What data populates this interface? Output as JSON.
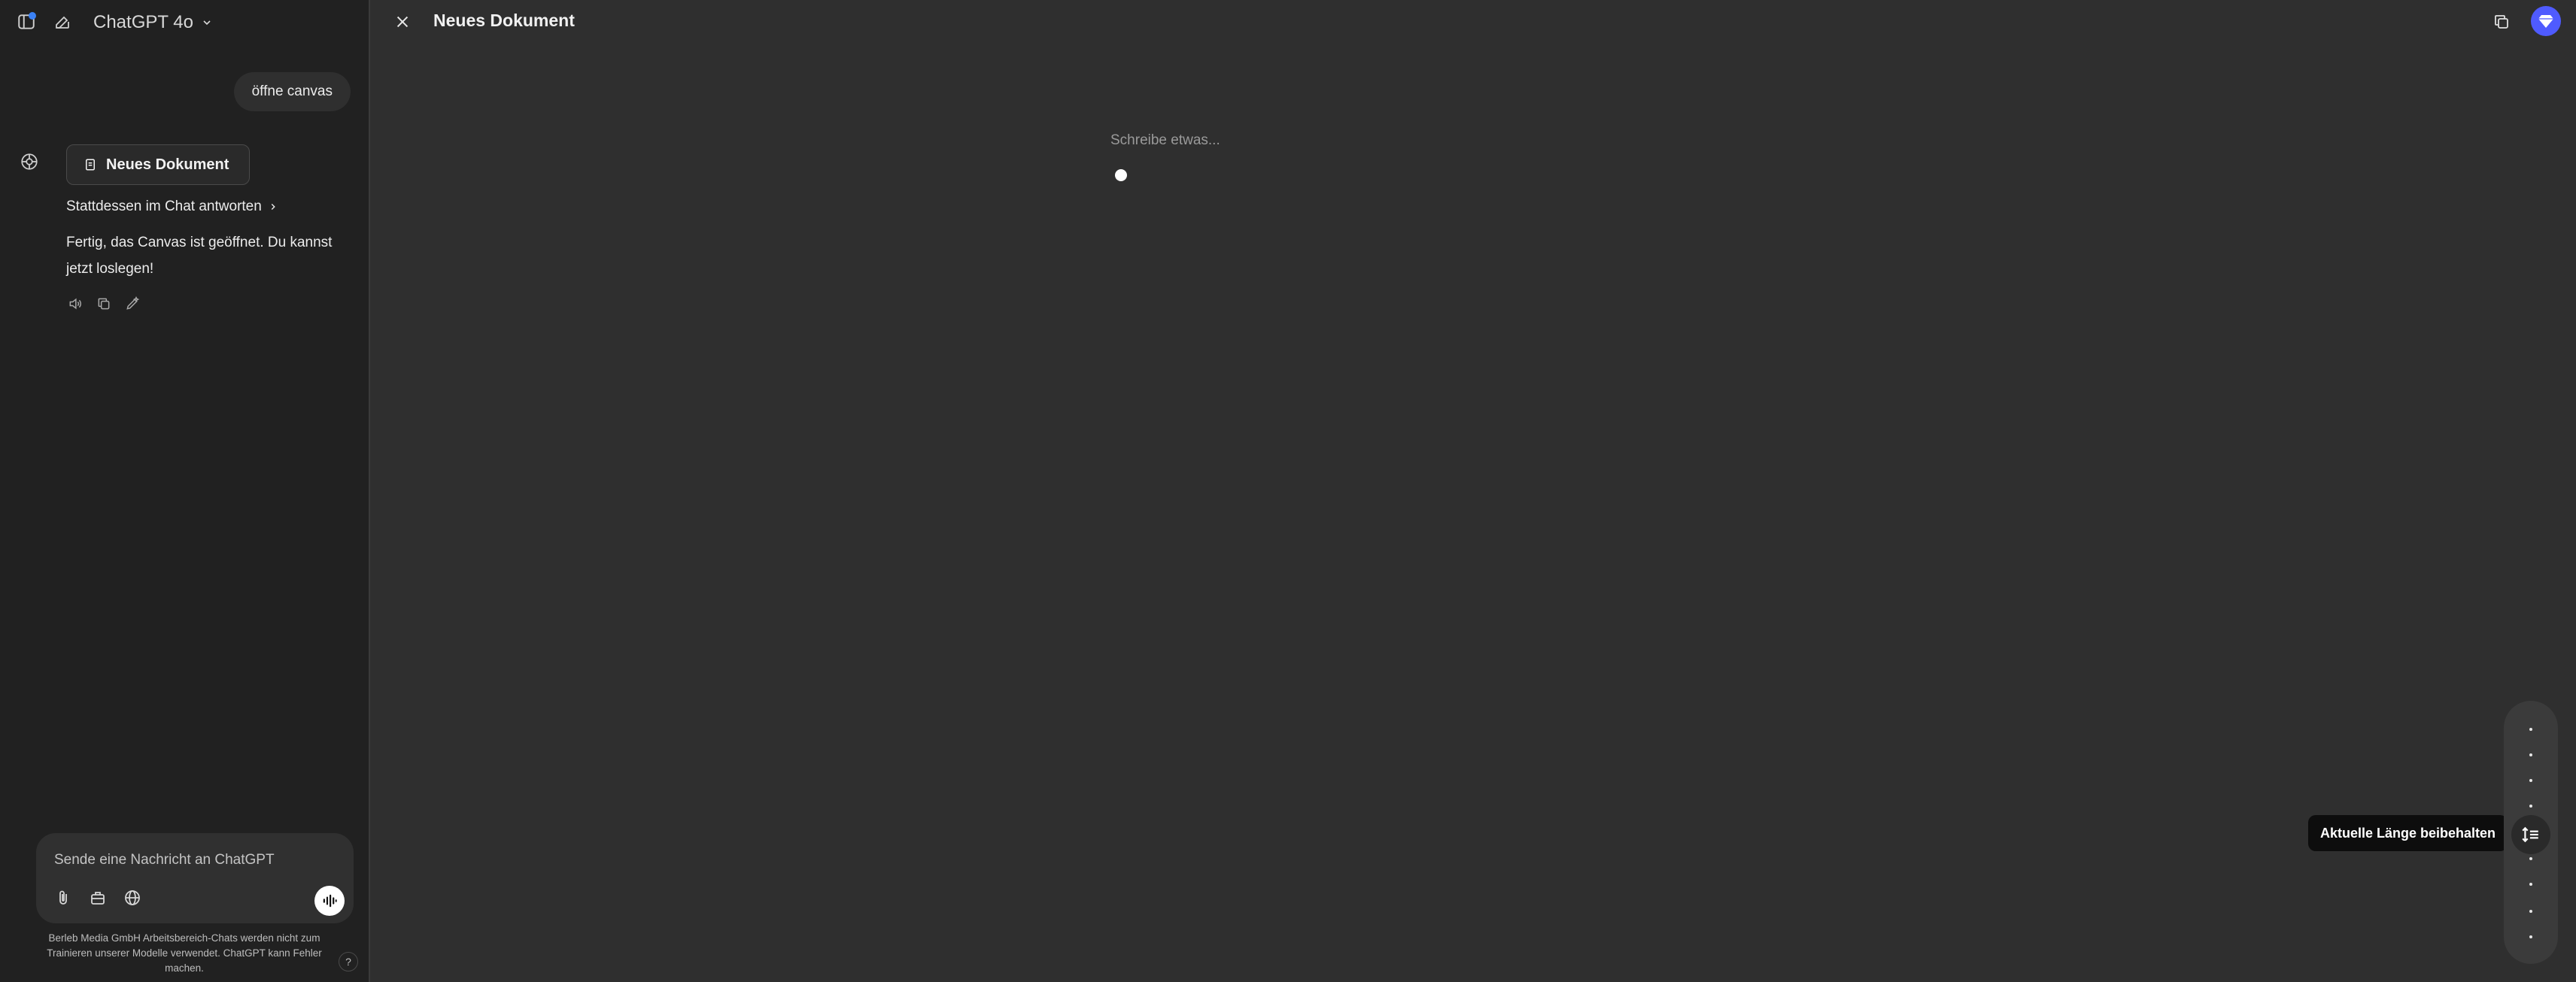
{
  "sidebar": {
    "model_name": "ChatGPT 4o",
    "user_message": "öffne canvas",
    "document_chip_label": "Neues Dokument",
    "alt_answer_link": "Stattdessen im Chat antworten",
    "assistant_message": "Fertig, das Canvas ist geöffnet. Du kannst jetzt loslegen!",
    "composer": {
      "placeholder": "Sende eine Nachricht an ChatGPT"
    },
    "disclaimer": "Berleb Media GmbH Arbeitsbereich-Chats werden nicht zum Trainieren unserer Modelle verwendet. ChatGPT kann Fehler machen.",
    "help_label": "?",
    "icons": {
      "sidebar_toggle": "sidebar-toggle-icon",
      "new_chat": "compose-icon",
      "model_chevron": "chevron-down-icon",
      "assistant": "openai-logo-icon",
      "document": "document-icon",
      "link_chevron": "chevron-right-icon",
      "read_aloud": "speaker-icon",
      "copy": "copy-icon",
      "edit": "edit-icon",
      "attach": "paperclip-icon",
      "tools": "toolbox-icon",
      "web": "globe-icon",
      "voice": "voice-waveform-icon"
    }
  },
  "canvas": {
    "title": "Neues Dokument",
    "editor_placeholder": "Schreibe etwas...",
    "length_tooltip": "Aktuelle Länge beibehalten",
    "icons": {
      "close": "close-icon",
      "copy": "copy-icon",
      "upgrade": "diamond-icon",
      "length": "adjust-length-icon"
    }
  },
  "colors": {
    "background": "#2f2f2f",
    "sidebar": "#212121",
    "accent": "#4f5bff",
    "notification": "#3b82f6"
  }
}
